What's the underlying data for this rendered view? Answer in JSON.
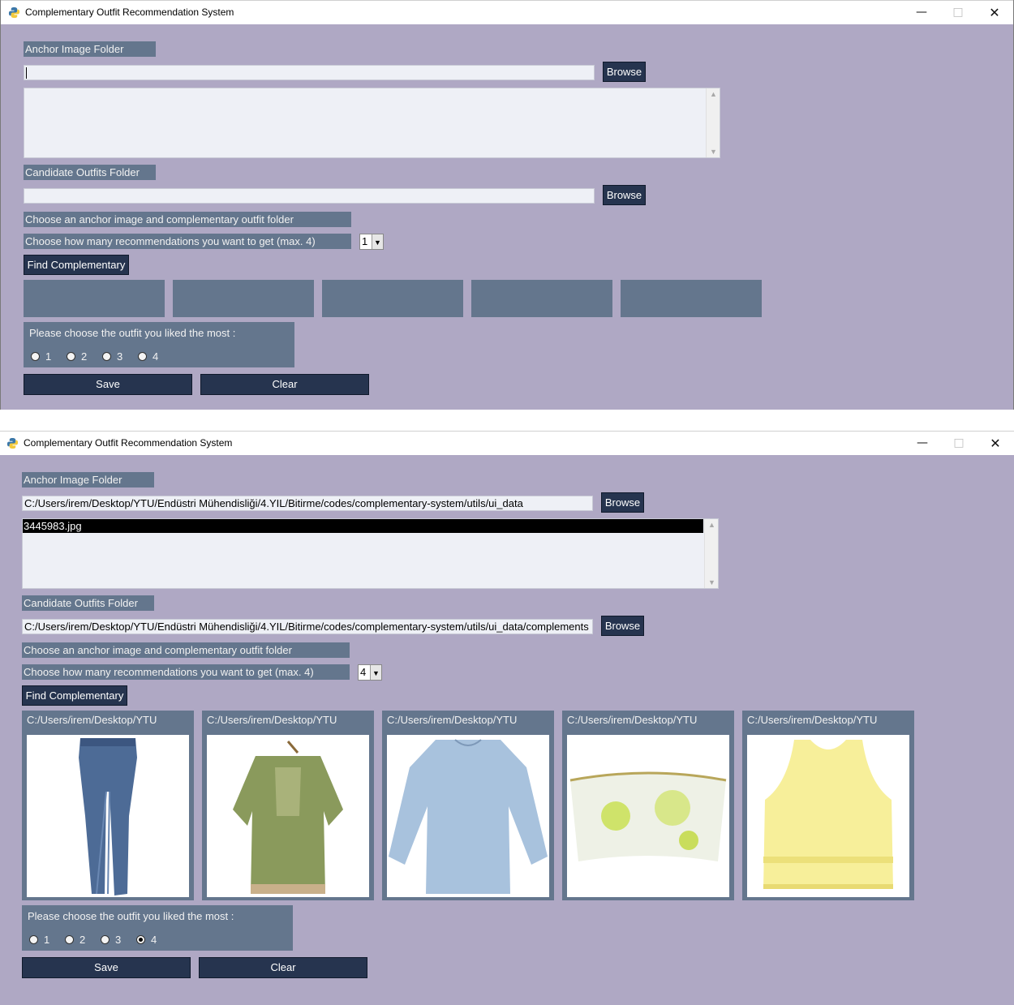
{
  "colors": {
    "window_bg": "#afa8c4",
    "label_bg": "#64768d",
    "button_bg": "#26344f",
    "entry_bg": "#eef0f6"
  },
  "windows": [
    {
      "title": "Complementary Outfit Recommendation System",
      "anchor_label": "Anchor Image Folder",
      "anchor_path": "",
      "browse_label": "Browse",
      "listbox_selected": "",
      "candidate_label": "Candidate Outfits Folder",
      "candidate_path": "",
      "status_text": "Choose an anchor image and complementary outfit folder",
      "count_label": "Choose how many recommendations you want to get (max. 4)",
      "count_value": "1",
      "find_label": "Find Complementary",
      "slots": [],
      "question": "Please choose the outfit you liked the most :",
      "radio_options": [
        "1",
        "2",
        "3",
        "4"
      ],
      "radio_selected": null,
      "save_label": "Save",
      "clear_label": "Clear"
    },
    {
      "title": "Complementary Outfit Recommendation System",
      "anchor_label": "Anchor Image Folder",
      "anchor_path": "C:/Users/irem/Desktop/YTU/Endüstri Mühendisliği/4.YIL/Bitirme/codes/complementary-system/utils/ui_data",
      "browse_label": "Browse",
      "listbox_selected": "3445983.jpg",
      "candidate_label": "Candidate Outfits Folder",
      "candidate_path": "C:/Users/irem/Desktop/YTU/Endüstri Mühendisliği/4.YIL/Bitirme/codes/complementary-system/utils/ui_data/complements",
      "status_text": "Choose an anchor image and complementary outfit folder",
      "count_label": "Choose how many recommendations you want to get (max. 4)",
      "count_value": "4",
      "find_label": "Find Complementary",
      "slots": [
        {
          "path": "C:/Users/irem/Desktop/YTU.",
          "image": "jeans-image"
        },
        {
          "path": "C:/Users/irem/Desktop/YTU.",
          "image": "green-blouse-image"
        },
        {
          "path": "C:/Users/irem/Desktop/YTU.",
          "image": "blue-top-image"
        },
        {
          "path": "C:/Users/irem/Desktop/YTU.",
          "image": "bandeau-top-image"
        },
        {
          "path": "C:/Users/irem/Desktop/YTU.",
          "image": "yellow-tank-image"
        }
      ],
      "question": "Please choose the outfit you liked the most :",
      "radio_options": [
        "1",
        "2",
        "3",
        "4"
      ],
      "radio_selected": "4",
      "save_label": "Save",
      "clear_label": "Clear"
    }
  ]
}
